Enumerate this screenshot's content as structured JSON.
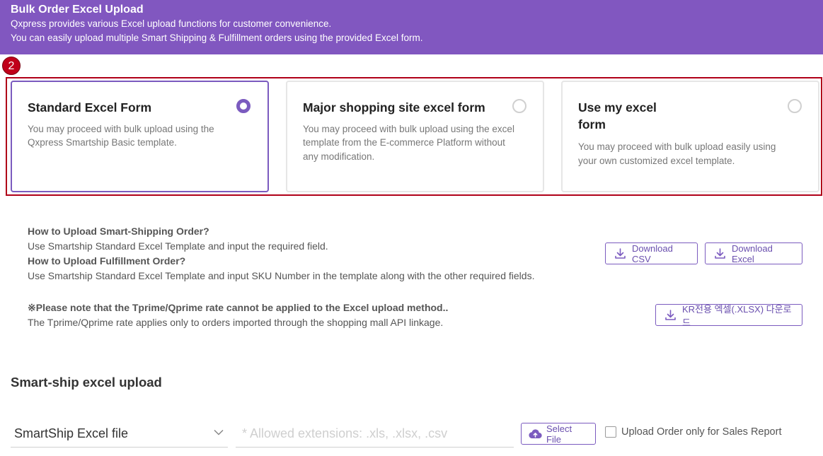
{
  "banner": {
    "title": "Bulk Order Excel Upload",
    "line1": "Qxpress provides various Excel upload functions for customer convenience.",
    "line2": "You can easily upload multiple Smart Shipping & Fulfillment orders using the provided Excel form."
  },
  "step_badge": "2",
  "cards": [
    {
      "title": "Standard Excel Form",
      "desc_lines": [
        "You may proceed with bulk upload using the",
        "Qxpress Smartship Basic template."
      ],
      "selected": true
    },
    {
      "title": "Major shopping site excel form",
      "desc_lines": [
        "You may proceed with bulk upload using the excel",
        "template from the E-commerce Platform without",
        "any modification."
      ],
      "selected": false
    },
    {
      "title_lines": [
        "Use my excel",
        "form"
      ],
      "desc_lines": [
        "You may proceed with bulk upload easily using",
        "your own customized excel template."
      ],
      "selected": false
    }
  ],
  "info": {
    "q1": "How to Upload Smart-Shipping Order?",
    "a1": "Use Smartship Standard Excel Template and input the required field.",
    "q2": "How to Upload Fulfillment Order?",
    "a2": "Use Smartship Standard Excel Template and input SKU Number in the template along with the other required fields.",
    "note_head": "※Please note that the Tprime/Qprime rate cannot be applied to the Excel upload method..",
    "note_text": "The Tprime/Qprime rate applies only to orders imported through the shopping mall API linkage."
  },
  "buttons": {
    "download_csv": "Download CSV",
    "download_excel": "Download Excel",
    "kr_download": "KR전용 엑셀(.XLSX) 다운로드",
    "select_file": "Select File"
  },
  "upload": {
    "section_title": "Smart-ship excel upload",
    "file_type_selected": "SmartShip Excel file",
    "file_placeholder": "* Allowed extensions: .xls, .xlsx, .csv",
    "sales_report_label": "Upload Order only for Sales Report"
  },
  "colors": {
    "banner": "#8157c0",
    "accent": "#7b5bbf",
    "highlight": "#b00018"
  },
  "icons": {
    "download": "download-icon",
    "upload": "cloud-upload-icon",
    "dropdown": "chevron-down-icon"
  }
}
